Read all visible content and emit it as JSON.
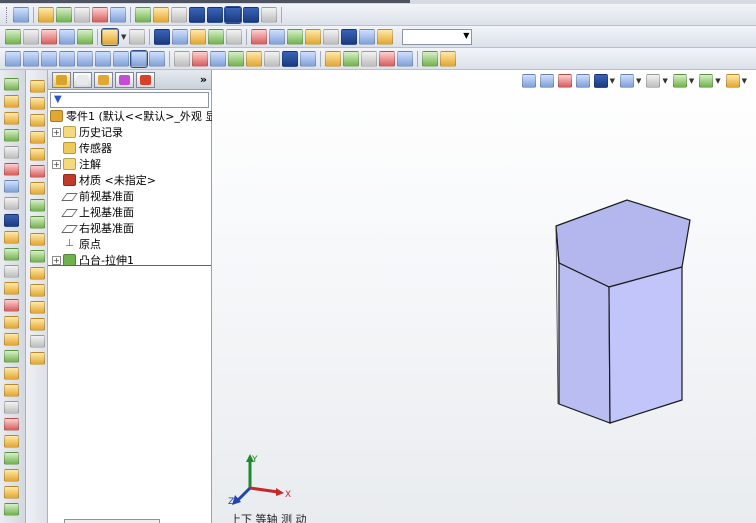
{
  "toolbar": {
    "row1_icons": [
      "pan-icon",
      "zoom-area-icon",
      "zoom-in-out-icon",
      "rotate-icon",
      "roll-icon",
      "pan-view-icon",
      "view-3d-icon",
      "isometric-icon",
      "trimetric-icon",
      "dimetric-icon",
      "shaded-with-edges-icon",
      "shaded-icon",
      "section-view-icon",
      "realview-icon"
    ],
    "row2_icons": [
      "new-icon",
      "open-icon",
      "save-icon",
      "print-icon",
      "rebuild-icon",
      "select-icon",
      "options-icon",
      "sketch-icon",
      "edges-icon",
      "hidden-lines-icon",
      "wireframe-icon",
      "shadows-icon",
      "appearance-icon",
      "scene-icon",
      "display-state-icon",
      "hide-show-icon",
      "view-orientation-icon",
      "curvature-icon",
      "zebra-icon",
      "perspective-icon"
    ],
    "row3_icons": [
      "front-view-icon",
      "back-view-icon",
      "left-view-icon",
      "right-view-icon",
      "top-view-icon",
      "bottom-view-icon",
      "isometric-view-icon",
      "normal-to-icon",
      "single-view-icon",
      "extrude-icon",
      "revolve-icon",
      "sweep-icon",
      "loft-icon",
      "fillet-icon",
      "chamfer-icon",
      "shell-icon",
      "rib-icon",
      "draft-icon",
      "hole-wizard-icon",
      "linear-pattern-icon",
      "mirror-icon",
      "reference-geometry-icon",
      "curves-icon",
      "instant3d-icon"
    ],
    "combo_value": ""
  },
  "panel": {
    "tabs": [
      {
        "name": "feature-manager-tab",
        "icon": "feature-tree-icon"
      },
      {
        "name": "property-manager-tab",
        "icon": "property-icon"
      },
      {
        "name": "configuration-manager-tab",
        "icon": "configuration-icon"
      },
      {
        "name": "dimxpert-manager-tab",
        "icon": "dimxpert-icon"
      },
      {
        "name": "display-manager-tab",
        "icon": "display-icon"
      }
    ],
    "expand_label": "»",
    "filter_icon": "filter-icon",
    "tree": [
      {
        "label": "零件1 (默认<<默认>_外观 显",
        "icon": "part-icon",
        "expander": "",
        "indent": 0
      },
      {
        "label": "历史记录",
        "icon": "history-folder-icon",
        "expander": "+",
        "indent": 1
      },
      {
        "label": "传感器",
        "icon": "sensor-icon",
        "expander": "",
        "indent": 1
      },
      {
        "label": "注解",
        "icon": "annotations-icon",
        "expander": "+",
        "indent": 1
      },
      {
        "label": "材质 <未指定>",
        "icon": "material-icon",
        "expander": "",
        "indent": 1
      },
      {
        "label": "前视基准面",
        "icon": "plane-icon",
        "expander": "",
        "indent": 1
      },
      {
        "label": "上视基准面",
        "icon": "plane-icon",
        "expander": "",
        "indent": 1
      },
      {
        "label": "右视基准面",
        "icon": "plane-icon",
        "expander": "",
        "indent": 1
      },
      {
        "label": "原点",
        "icon": "origin-icon",
        "expander": "",
        "indent": 1
      },
      {
        "label": "凸台-拉伸1",
        "icon": "extrude-feature-icon",
        "expander": "+",
        "indent": 1
      }
    ]
  },
  "viewport": {
    "model": "hexagonal-prism",
    "model_color": "#b9bdf0",
    "triad_labels": {
      "x": "X",
      "y": "Y",
      "z": "Z"
    },
    "status_text": "上下  等轴 测 动"
  },
  "colors": {
    "toolbar_bg": "#e4e7ec",
    "selection_line": "#3b63c4",
    "model_face": "#b9bdf0",
    "model_edge": "#1a1a1a"
  }
}
